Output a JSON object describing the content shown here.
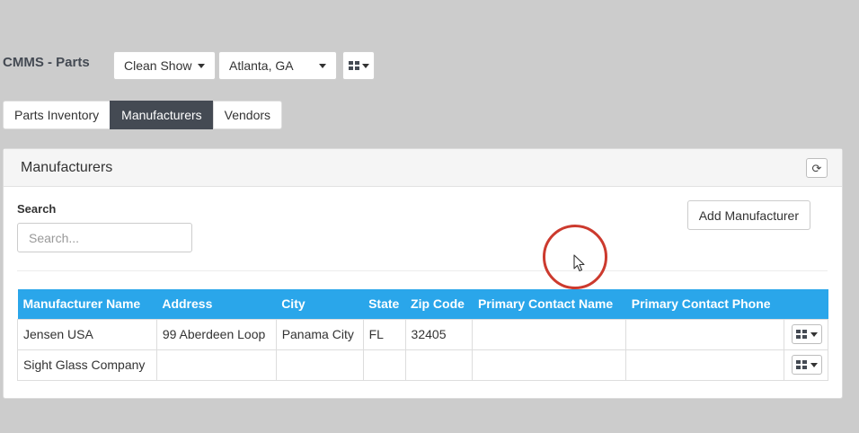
{
  "header": {
    "app_title": "CMMS - Parts",
    "show_filter": "Clean Show",
    "location": "Atlanta, GA",
    "view_menu_icon": "grid-icon"
  },
  "tabs": [
    {
      "label": "Parts Inventory",
      "active": false
    },
    {
      "label": "Manufacturers",
      "active": true
    },
    {
      "label": "Vendors",
      "active": false
    }
  ],
  "panel": {
    "title": "Manufacturers",
    "refresh_icon": "refresh-icon",
    "search": {
      "label": "Search",
      "placeholder": "Search...",
      "value": ""
    },
    "add_button": "Add Manufacturer"
  },
  "table": {
    "columns": [
      "Manufacturer Name",
      "Address",
      "City",
      "State",
      "Zip Code",
      "Primary Contact Name",
      "Primary Contact Phone"
    ],
    "rows": [
      {
        "name": "Jensen USA",
        "address": "99 Aberdeen Loop",
        "city": "Panama City",
        "state": "FL",
        "zip": "32405",
        "contact_name": "",
        "contact_phone": ""
      },
      {
        "name": "Sight Glass Company",
        "address": "",
        "city": "",
        "state": "",
        "zip": "",
        "contact_name": "",
        "contact_phone": ""
      }
    ]
  },
  "colors": {
    "accent": "#2aa6ea",
    "active_tab": "#444a53",
    "background": "#cccccc",
    "cursor_highlight": "#cc3a2e"
  }
}
